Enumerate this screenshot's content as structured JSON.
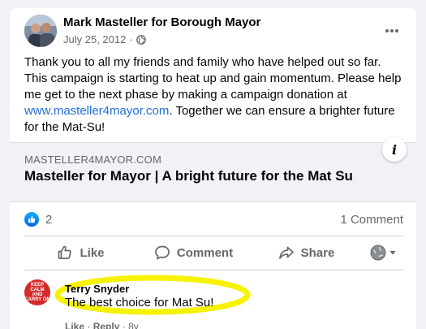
{
  "post": {
    "author": "Mark Masteller for Borough Mayor",
    "date": "July 25, 2012",
    "separator": "·",
    "privacy_icon": "globe-icon",
    "more_icon": "more-options-icon",
    "text_part1": "Thank you to all my friends and family who have helped out so far. This campaign is starting to heat up and gain momentum.  Please help me get to the next phase by making a campaign donation at ",
    "link_text": "www.masteller4mayor.com",
    "text_part2": ".  Together we can ensure a brighter future for the Mat-Su!"
  },
  "link_preview": {
    "domain": "MASTELLER4MAYOR.COM",
    "title": "Masteller for Mayor | A bright future for the Mat Su",
    "info_label": "i"
  },
  "reactions": {
    "count": "2",
    "comments": "1 Comment"
  },
  "actions": {
    "like": "Like",
    "comment": "Comment",
    "share": "Share"
  },
  "comment": {
    "avatar_lines": [
      "KEEP",
      "CALM",
      "AND",
      "CARRY ON"
    ],
    "name": "Terry Snyder",
    "text": "The best choice for Mat Su!",
    "like": "Like",
    "dot": "·",
    "reply": "Reply",
    "age": "8y"
  },
  "colors": {
    "link": "#216fdb",
    "highlight": "#f6f200",
    "like_blue": "#0866ff",
    "secondary_text": "#65676b"
  }
}
